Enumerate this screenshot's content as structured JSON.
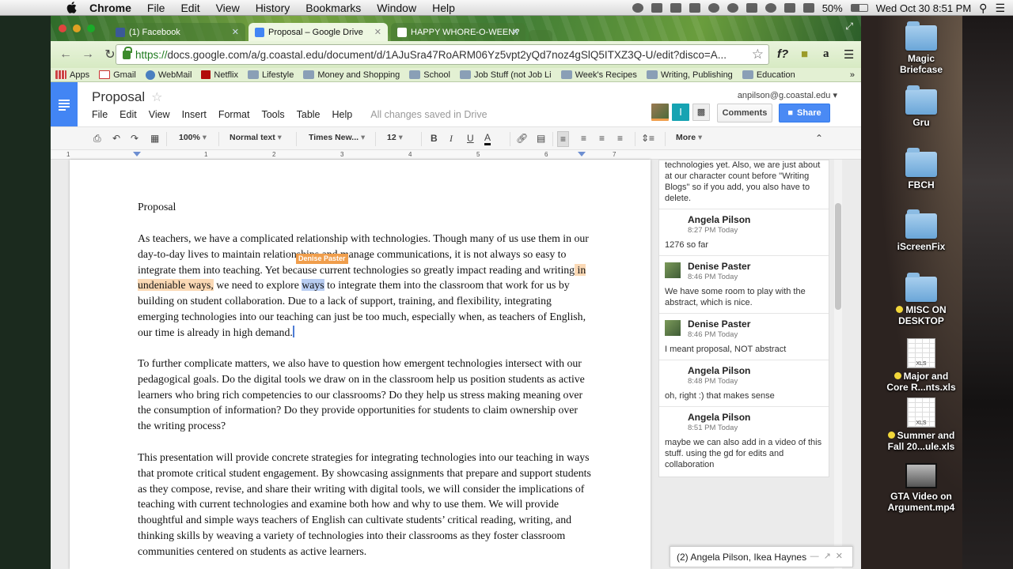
{
  "menubar": {
    "app": "Chrome",
    "items": [
      "File",
      "Edit",
      "View",
      "History",
      "Bookmarks",
      "Window",
      "Help"
    ],
    "battery": "50%",
    "clock": "Wed Oct 30  8:51 PM"
  },
  "tabs": [
    {
      "label": "(1) Facebook",
      "color": "#3b5998"
    },
    {
      "label": "Proposal – Google Drive",
      "color": "#4285f4"
    },
    {
      "label": "HAPPY WHORE-O-WEEN?",
      "color": "#ffffff"
    }
  ],
  "toolbar": {
    "url_scheme": "https://",
    "url_rest": "docs.google.com/a/g.coastal.edu/document/d/1AJuSra47RoARM06Yz5vpt2yQd7noz4gSlQ5ITXZ3Q-U/edit?disco=A..."
  },
  "bookmarks": [
    "Apps",
    "Gmail",
    "WebMail",
    "Netflix",
    "Lifestyle",
    "Money and Shopping",
    "School",
    "Job Stuff (not Job Li",
    "Week's Recipes",
    "Writing, Publishing",
    "Education"
  ],
  "docs": {
    "title": "Proposal",
    "menu": [
      "File",
      "Edit",
      "View",
      "Insert",
      "Format",
      "Tools",
      "Table",
      "Help"
    ],
    "saved": "All changes saved in Drive",
    "account": "anpilson@g.coastal.edu",
    "comments_btn": "Comments",
    "share_btn": "Share"
  },
  "format": {
    "zoom": "100%",
    "style": "Normal text",
    "font": "Times New...",
    "size": "12",
    "more": "More"
  },
  "ruler": [
    "1",
    "1",
    "2",
    "3",
    "4",
    "5",
    "6",
    "7"
  ],
  "document": {
    "heading": "Proposal",
    "p1_a": "As teachers, we have a complicated relationship with technologies. Though many of us use them in our day-to-day lives to maintain relationships and manage communications, it is not always so easy to integrate them into teaching. Yet because current technologies so greatly impact reading and writing",
    "p1_hl1": " in undeniable ways,",
    "p1_b": " we need to explore ",
    "p1_hl2": "ways",
    "p1_c": " to integrate them into the classroom that work for us by building on student collaboration. Due to a lack of support, training, and flexibility, integrating emerging technologies into our teaching can just be too much, especially when, as teachers of English, our time is already in high demand.",
    "collab_label": "Denise Paster",
    "p2": "To further complicate matters, we also have to question how emergent technologies intersect with our pedagogical goals. Do the digital tools we draw on in the classroom help us position students as active learners who bring rich competencies to our classrooms? Do they help us stress making meaning over the consumption of information? Do they provide opportunities for students to claim ownership over the writing process?",
    "p3": "This presentation will provide concrete strategies for integrating technologies into our teaching in ways that promote critical student engagement. By showcasing assignments that prepare and support students as they compose, revise, and share their writing with digital tools, we will consider the implications of teaching with current technologies and examine both how and why to use them. We will provide thoughtful and simple ways teachers of English can cultivate students’ critical reading, writing, and thinking skills by weaving a variety of technologies into their classrooms as they foster classroom communities centered on students as active learners."
  },
  "comments": {
    "partial": "technologies yet. Also, we are just about at our character count before \"Writing Blogs\" so if you add, you also have to delete.",
    "items": [
      {
        "author": "Angela Pilson",
        "time": "8:27 PM Today",
        "text": "1276 so far"
      },
      {
        "author": "Denise Paster",
        "time": "8:46 PM Today",
        "text": "We have some room to play with the abstract, which is nice."
      },
      {
        "author": "Denise Paster",
        "time": "8:46 PM Today",
        "text": "I meant proposal, NOT abstract"
      },
      {
        "author": "Angela Pilson",
        "time": "8:48 PM Today",
        "text": "oh, right :) that makes sense"
      },
      {
        "author": "Angela Pilson",
        "time": "8:51 PM Today",
        "text": "maybe we can also add in a video of this stuff. using the gd for edits and collaboration"
      }
    ]
  },
  "chat": {
    "label": "(2) Angela Pilson, Ikea Haynes"
  },
  "desktop": [
    {
      "label": "Magic Briefcase",
      "kind": "folder"
    },
    {
      "label": "Gru",
      "kind": "folder"
    },
    {
      "label": "FBCH",
      "kind": "folder"
    },
    {
      "label": "iScreenFix",
      "kind": "folder"
    },
    {
      "label": "MISC ON DESKTOP",
      "kind": "folder"
    },
    {
      "label": "Major and Core R...nts.xls",
      "kind": "xls"
    },
    {
      "label": "Summer and Fall 20...ule.xls",
      "kind": "xls"
    },
    {
      "label": "GTA Video on Argument.mp4",
      "kind": "video"
    }
  ],
  "desktop_file_tag": "XLS"
}
